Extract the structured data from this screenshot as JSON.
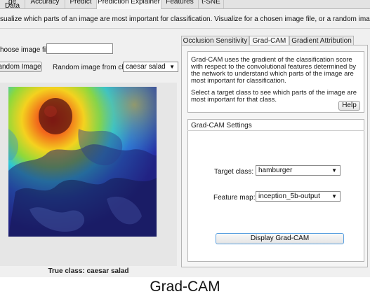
{
  "tabs": [
    {
      "label": "ge Data"
    },
    {
      "label": "Accuracy"
    },
    {
      "label": "Predict"
    },
    {
      "label": "Prediction Explainer",
      "active": true
    },
    {
      "label": "Features"
    },
    {
      "label": "t-SNE"
    }
  ],
  "description": "sualize which parts of an image are most important for classification. Visualize for a chosen image file, or a random image from the test data.",
  "left": {
    "choose_file_label": "hoose image file:",
    "file_value": "",
    "random_button": "andom Image",
    "random_class_label": "Random image from class",
    "random_class_value": "caesar salad",
    "true_class": "True class: caesar salad"
  },
  "method_tabs": [
    {
      "label": "Occlusion Sensitivity"
    },
    {
      "label": "Grad-CAM",
      "active": true
    },
    {
      "label": "Gradient Attribution"
    }
  ],
  "info": {
    "para1": "Grad-CAM uses the gradient of the classification score with respect to the convolutional features determined by the network to understand which parts of the image are most important for classification.",
    "para2": "Select a target class to see which parts of the image are most important for that class.",
    "help_button": "Help"
  },
  "settings": {
    "title": "Grad-CAM Settings",
    "target_class_label": "Target class:",
    "target_class_value": "hamburger",
    "feature_map_label": "Feature map:",
    "feature_map_value": "inception_5b-output",
    "display_button": "Display Grad-CAM"
  },
  "caption": "Grad-CAM",
  "colors": {
    "accent": "#3a7bd5",
    "button_focus": "#5aa0e0"
  }
}
